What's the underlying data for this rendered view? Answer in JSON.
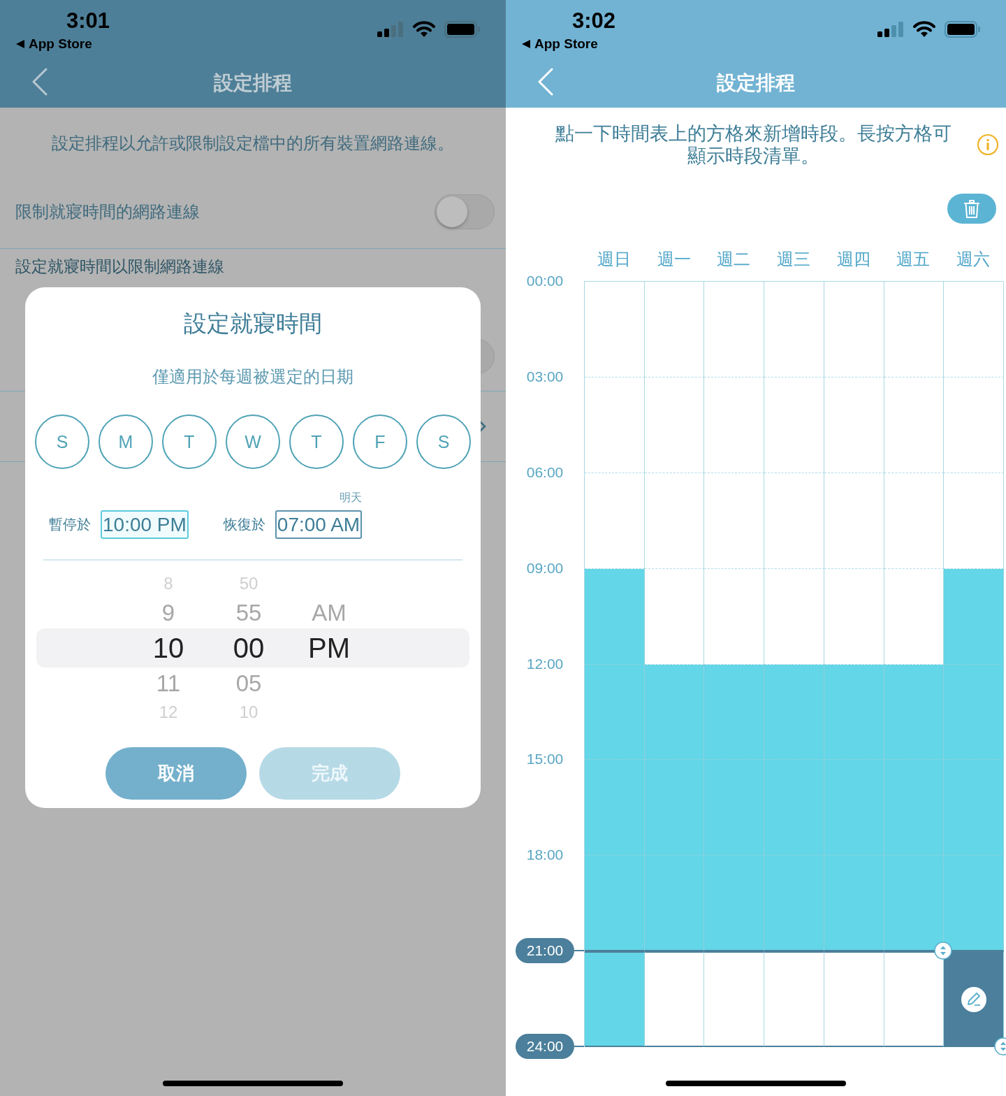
{
  "left_screen": {
    "status_bar": {
      "time": "3:01",
      "back_app": "App Store"
    },
    "nav_bar": {
      "title": "設定排程"
    },
    "description": "設定排程以允許或限制設定檔中的所有裝置網路連線。",
    "settings": [
      {
        "kind": "toggle",
        "label": "限制就寢時間的網路連線",
        "on": false
      },
      {
        "kind": "header",
        "label": "設定就寢時間以限制網路連線"
      },
      {
        "kind": "covered_toggle",
        "on": false
      },
      {
        "kind": "covered_link"
      }
    ],
    "dialog": {
      "title": "設定就寢時間",
      "subtitle": "僅適用於每週被選定的日期",
      "days": [
        {
          "label": "S",
          "selected": false
        },
        {
          "label": "M",
          "selected": false
        },
        {
          "label": "T",
          "selected": false
        },
        {
          "label": "W",
          "selected": false
        },
        {
          "label": "T",
          "selected": false
        },
        {
          "label": "F",
          "selected": false
        },
        {
          "label": "S",
          "selected": false
        }
      ],
      "times": [
        {
          "label": "暫停於",
          "value": "10:00 PM",
          "selected": true
        },
        {
          "label": "恢復於",
          "value": "07:00 AM",
          "note": "明天",
          "selected": false
        }
      ],
      "picker": [
        {
          "items": [
            {
              "label": "8",
              "selected": false
            },
            {
              "label": "9",
              "selected": false
            },
            {
              "label": "10",
              "selected": true
            },
            {
              "label": "11",
              "selected": false
            },
            {
              "label": "12",
              "selected": false
            }
          ]
        },
        {
          "items": [
            {
              "label": "50",
              "selected": false
            },
            {
              "label": "55",
              "selected": false
            },
            {
              "label": "00",
              "selected": true
            },
            {
              "label": "05",
              "selected": false
            },
            {
              "label": "10",
              "selected": false
            }
          ]
        },
        {
          "items": [
            {
              "label": "AM",
              "selected": false
            },
            {
              "label": "PM",
              "selected": true
            }
          ]
        }
      ],
      "buttons": [
        {
          "label": "取消",
          "disabled": false
        },
        {
          "label": "完成",
          "disabled": true
        }
      ]
    }
  },
  "right_screen": {
    "status_bar": {
      "time": "3:02",
      "back_app": "App Store"
    },
    "nav_bar": {
      "title": "設定排程"
    },
    "hint": "點一下時間表上的方格來新增時段。長按方格可顯示時段清單。",
    "schedule": {
      "time_labels": [
        {
          "label": "00:00",
          "highlighted": false
        },
        {
          "label": "03:00",
          "highlighted": false
        },
        {
          "label": "06:00",
          "highlighted": false
        },
        {
          "label": "09:00",
          "highlighted": false
        },
        {
          "label": "12:00",
          "highlighted": false
        },
        {
          "label": "15:00",
          "highlighted": false
        },
        {
          "label": "18:00",
          "highlighted": false
        },
        {
          "label": "21:00",
          "highlighted": true
        },
        {
          "label": "24:00",
          "highlighted": true
        }
      ],
      "days": [
        {
          "label": "週日",
          "slots": [
            {
              "filled": false,
              "selected": false
            },
            {
              "filled": false,
              "selected": false
            },
            {
              "filled": false,
              "selected": false
            },
            {
              "filled": true,
              "selected": false
            },
            {
              "filled": true,
              "selected": false
            },
            {
              "filled": true,
              "selected": false
            },
            {
              "filled": true,
              "selected": false
            },
            {
              "filled": true,
              "selected": false
            }
          ]
        },
        {
          "label": "週一",
          "slots": [
            {
              "filled": false,
              "selected": false
            },
            {
              "filled": false,
              "selected": false
            },
            {
              "filled": false,
              "selected": false
            },
            {
              "filled": false,
              "selected": false
            },
            {
              "filled": true,
              "selected": false
            },
            {
              "filled": true,
              "selected": false
            },
            {
              "filled": true,
              "selected": false
            },
            {
              "filled": false,
              "selected": false
            }
          ]
        },
        {
          "label": "週二",
          "slots": [
            {
              "filled": false,
              "selected": false
            },
            {
              "filled": false,
              "selected": false
            },
            {
              "filled": false,
              "selected": false
            },
            {
              "filled": false,
              "selected": false
            },
            {
              "filled": true,
              "selected": false
            },
            {
              "filled": true,
              "selected": false
            },
            {
              "filled": true,
              "selected": false
            },
            {
              "filled": false,
              "selected": false
            }
          ]
        },
        {
          "label": "週三",
          "slots": [
            {
              "filled": false,
              "selected": false
            },
            {
              "filled": false,
              "selected": false
            },
            {
              "filled": false,
              "selected": false
            },
            {
              "filled": false,
              "selected": false
            },
            {
              "filled": true,
              "selected": false
            },
            {
              "filled": true,
              "selected": false
            },
            {
              "filled": true,
              "selected": false
            },
            {
              "filled": false,
              "selected": false
            }
          ]
        },
        {
          "label": "週四",
          "slots": [
            {
              "filled": false,
              "selected": false
            },
            {
              "filled": false,
              "selected": false
            },
            {
              "filled": false,
              "selected": false
            },
            {
              "filled": false,
              "selected": false
            },
            {
              "filled": true,
              "selected": false
            },
            {
              "filled": true,
              "selected": false
            },
            {
              "filled": true,
              "selected": false
            },
            {
              "filled": false,
              "selected": false
            }
          ]
        },
        {
          "label": "週五",
          "slots": [
            {
              "filled": false,
              "selected": false
            },
            {
              "filled": false,
              "selected": false
            },
            {
              "filled": false,
              "selected": false
            },
            {
              "filled": false,
              "selected": false
            },
            {
              "filled": true,
              "selected": false
            },
            {
              "filled": true,
              "selected": false
            },
            {
              "filled": true,
              "selected": false
            },
            {
              "filled": false,
              "selected": false
            }
          ]
        },
        {
          "label": "週六",
          "slots": [
            {
              "filled": false,
              "selected": false
            },
            {
              "filled": false,
              "selected": false
            },
            {
              "filled": false,
              "selected": false
            },
            {
              "filled": true,
              "selected": false
            },
            {
              "filled": true,
              "selected": false
            },
            {
              "filled": true,
              "selected": false
            },
            {
              "filled": true,
              "selected": false
            },
            {
              "filled": true,
              "selected": true
            }
          ]
        }
      ]
    }
  }
}
